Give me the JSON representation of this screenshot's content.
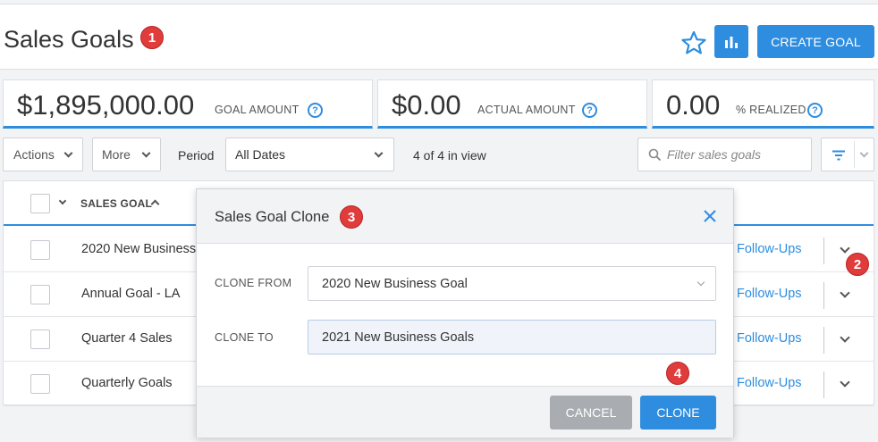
{
  "page": {
    "title": "Sales Goals",
    "create_button": "CREATE GOAL"
  },
  "stats": [
    {
      "value": "$1,895,000.00",
      "label": "GOAL AMOUNT"
    },
    {
      "value": "$0.00",
      "label": "ACTUAL AMOUNT"
    },
    {
      "value": "0.00",
      "label": "% REALIZED"
    }
  ],
  "help_glyph": "?",
  "toolbar": {
    "actions_label": "Actions",
    "more_label": "More",
    "period_label": "Period",
    "period_value": "All Dates",
    "in_view": "4 of 4 in view",
    "filter_placeholder": "Filter sales goals"
  },
  "table": {
    "column_header": "SALES GOAL",
    "rows": [
      {
        "name": "2020 New Business",
        "link": "Follow-Ups"
      },
      {
        "name": "Annual Goal - LA",
        "link": "Follow-Ups"
      },
      {
        "name": "Quarter 4 Sales",
        "link": "Follow-Ups"
      },
      {
        "name": "Quarterly Goals",
        "link": "Follow-Ups"
      }
    ]
  },
  "modal": {
    "title": "Sales Goal Clone",
    "clone_from_label": "CLONE FROM",
    "clone_from_value": "2020 New Business Goal",
    "clone_to_label": "CLONE TO",
    "clone_to_value": "2021 New Business Goals",
    "cancel_label": "CANCEL",
    "clone_label": "CLONE"
  },
  "markers": [
    "1",
    "2",
    "3",
    "4"
  ],
  "colors": {
    "accent": "#2e8ddf",
    "marker": "#e03c3c",
    "cancel": "#a9adb2"
  }
}
